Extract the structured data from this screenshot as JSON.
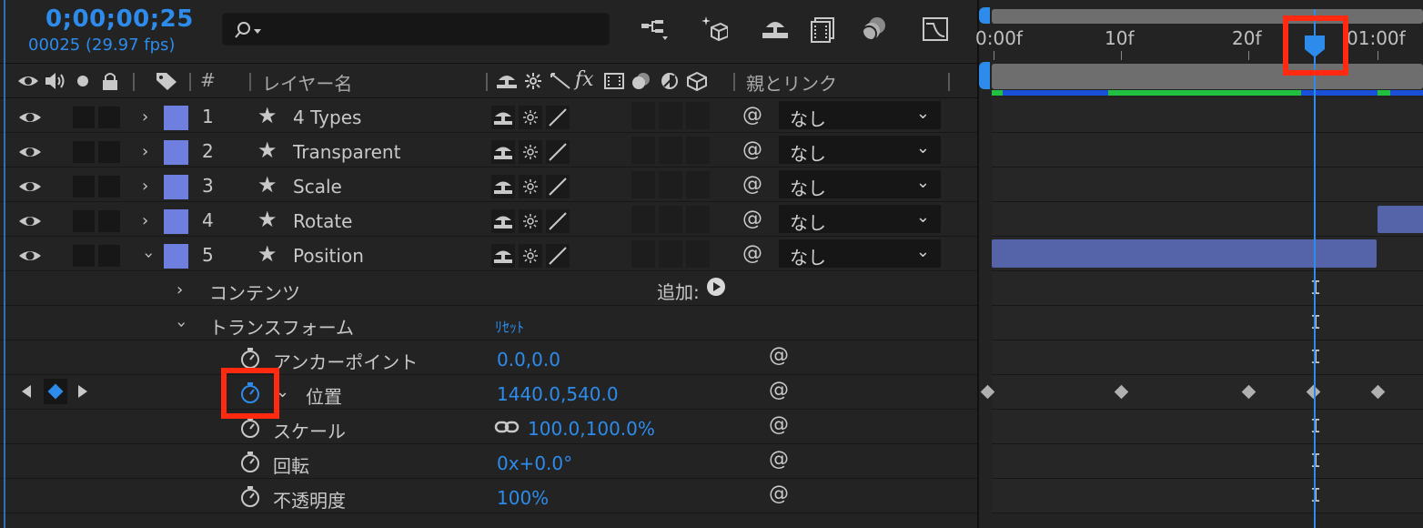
{
  "timecode": "0;00;00;25",
  "frame_info": "00025 (29.97 fps)",
  "columns": {
    "hash": "#",
    "layer_name": "レイヤー名",
    "parent_link": "親とリンク"
  },
  "layers": [
    {
      "num": "1",
      "name": "4 Types",
      "parent": "なし",
      "expanded": false
    },
    {
      "num": "2",
      "name": "Transparent",
      "parent": "なし",
      "expanded": false
    },
    {
      "num": "3",
      "name": "Scale",
      "parent": "なし",
      "expanded": false
    },
    {
      "num": "4",
      "name": "Rotate",
      "parent": "なし",
      "expanded": false
    },
    {
      "num": "5",
      "name": "Position",
      "parent": "なし",
      "expanded": true
    }
  ],
  "contents": {
    "label": "コンテンツ",
    "add_label": "追加:"
  },
  "transform": {
    "label": "トランスフォーム",
    "reset_label": "ﾘｾｯﾄ"
  },
  "properties": [
    {
      "name": "アンカーポイント",
      "value": "0.0,0.0"
    },
    {
      "name": "位置",
      "value": "1440.0,540.0"
    },
    {
      "name": "スケール",
      "value": "100.0,100.0%"
    },
    {
      "name": "回転",
      "value": "0x+0.0°"
    },
    {
      "name": "不透明度",
      "value": "100%"
    }
  ],
  "ruler": {
    "labels": [
      "0:00f",
      "10f",
      "20f",
      "01:00f"
    ]
  },
  "colors": {
    "accent": "#2d8ceb",
    "label_purple": "#6e7fe0",
    "layer_bar": "#5563a8",
    "highlight_red": "#ff2a10"
  }
}
